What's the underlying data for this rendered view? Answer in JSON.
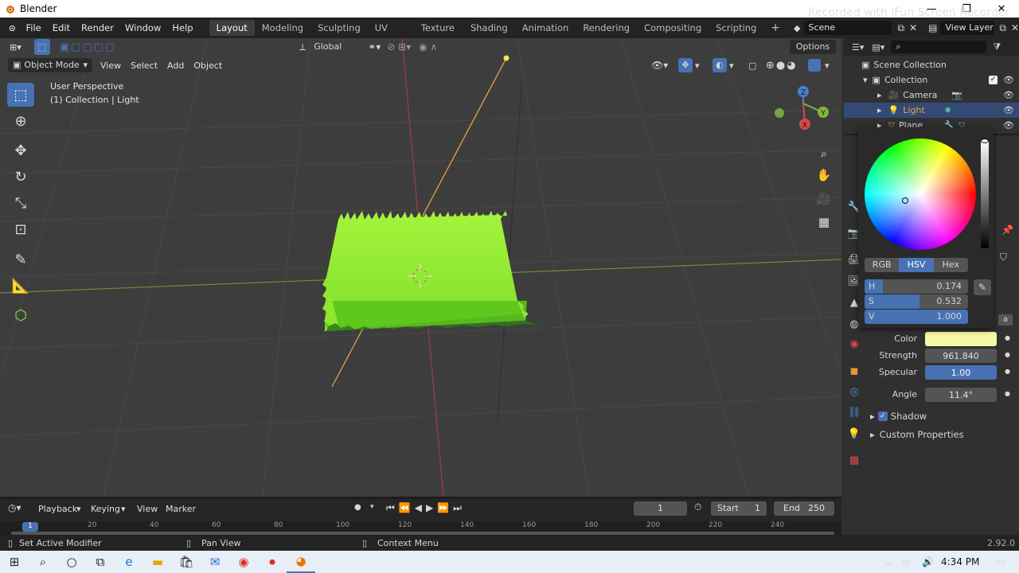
{
  "window": {
    "title": "Blender",
    "minimize": "—",
    "maximize": "❐",
    "close": "✕"
  },
  "watermark": "Recorded with iFun Screen Recorder",
  "menubar": {
    "items": [
      "File",
      "Edit",
      "Render",
      "Window",
      "Help"
    ]
  },
  "workspaces": [
    "Layout",
    "Modeling",
    "Sculpting",
    "UV Editing",
    "Texture Paint",
    "Shading",
    "Animation",
    "Rendering",
    "Compositing",
    "Scripting"
  ],
  "workspace_add": "+",
  "scene": {
    "label": "Scene",
    "viewlayer": "View Layer"
  },
  "viewport": {
    "orientation": "Global",
    "options": "Options",
    "mode": "Object Mode",
    "menu": [
      "View",
      "Select",
      "Add",
      "Object"
    ],
    "overlay_title": "User Perspective",
    "overlay_sub": "(1) Collection | Light",
    "gizmo": {
      "z": "Z",
      "y": "Y",
      "x": "X"
    },
    "toolbar_icons": [
      "select-box-icon",
      "cursor-icon",
      "move-icon",
      "rotate-icon",
      "scale-icon",
      "transform-icon",
      "annotate-icon",
      "measure-icon",
      "add-cube-icon"
    ],
    "nav_icons": [
      "zoom-icon",
      "pan-hand-icon",
      "camera-view-icon",
      "grid-view-icon"
    ]
  },
  "outliner": {
    "root": "Scene Collection",
    "collection": "Collection",
    "items": [
      {
        "name": "Camera",
        "icon": "camera-icon"
      },
      {
        "name": "Light",
        "icon": "light-icon"
      },
      {
        "name": "Plane",
        "icon": "mesh-icon"
      }
    ]
  },
  "colorpicker": {
    "modes": [
      "RGB",
      "HSV",
      "Hex"
    ],
    "active_mode": "HSV",
    "h_label": "H",
    "h": "0.174",
    "h_frac": 0.174,
    "s_label": "S",
    "s": "0.532",
    "s_frac": 0.532,
    "v_label": "V",
    "v": "1.000",
    "v_frac": 1.0
  },
  "light": {
    "color_label": "Color",
    "color": "#f6f8a4",
    "strength_label": "Strength",
    "strength": "961.840",
    "specular_label": "Specular",
    "specular": "1.00",
    "angle_label": "Angle",
    "angle": "11.4°",
    "shadow": "Shadow",
    "custom": "Custom Properties",
    "partial": "a"
  },
  "timeline": {
    "menu": [
      "Playback",
      "Keying",
      "View",
      "Marker"
    ],
    "frame": "1",
    "start_label": "Start",
    "start": "1",
    "end_label": "End",
    "end": "250",
    "ticks": [
      "1",
      "20",
      "40",
      "60",
      "80",
      "100",
      "120",
      "140",
      "160",
      "180",
      "200",
      "220",
      "240"
    ]
  },
  "status": {
    "left": "Set Active Modifier",
    "mid": "Pan View",
    "right": "Context Menu",
    "version": "2.92.0"
  },
  "taskbar": {
    "time": "4:34 PM"
  },
  "colors": {
    "accent": "#4772b3",
    "grass": "#8fef2f",
    "selected": "#334a74"
  }
}
